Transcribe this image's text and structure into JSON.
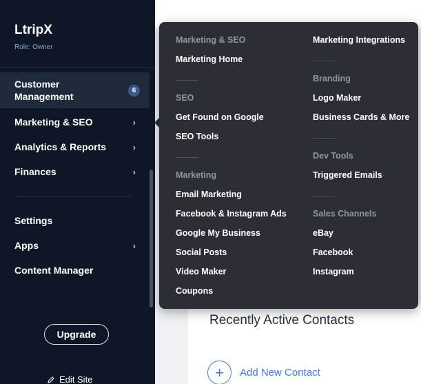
{
  "sidebar": {
    "brand": "LtripX",
    "role": "Role: Owner",
    "items": [
      {
        "label": "Customer Management",
        "badge": "6"
      },
      {
        "label": "Marketing & SEO"
      },
      {
        "label": "Analytics & Reports"
      },
      {
        "label": "Finances"
      },
      {
        "label": "Settings"
      },
      {
        "label": "Apps"
      },
      {
        "label": "Content Manager"
      }
    ],
    "upgrade_label": "Upgrade",
    "edit_site_label": "Edit Site"
  },
  "flyout": {
    "left": {
      "marketing_seo_head": "Marketing & SEO",
      "marketing_home": "Marketing Home",
      "seo_head": "SEO",
      "get_found": "Get Found on Google",
      "seo_tools": "SEO Tools",
      "marketing_head": "Marketing",
      "email_marketing": "Email Marketing",
      "fb_ig_ads": "Facebook & Instagram Ads",
      "google_my_business": "Google My Business",
      "social_posts": "Social Posts",
      "video_maker": "Video Maker",
      "coupons": "Coupons"
    },
    "right": {
      "marketing_integrations": "Marketing Integrations",
      "branding_head": "Branding",
      "logo_maker": "Logo Maker",
      "business_cards": "Business Cards & More",
      "dev_tools_head": "Dev Tools",
      "triggered_emails": "Triggered Emails",
      "sales_channels_head": "Sales Channels",
      "ebay": "eBay",
      "facebook": "Facebook",
      "instagram": "Instagram"
    }
  },
  "main": {
    "recent_contacts_title": "Recently Active Contacts",
    "add_contact_label": "Add New Contact"
  },
  "colors": {
    "sidebar_bg": "#0e1726",
    "flyout_bg": "#2b2f35",
    "accent": "#3d7ae6"
  }
}
